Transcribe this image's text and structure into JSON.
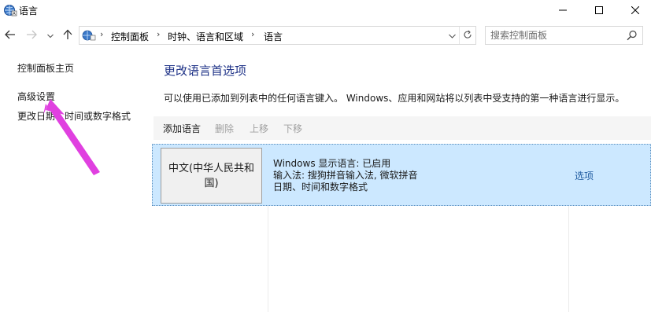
{
  "window": {
    "title": "语言",
    "icon": "globe-language-icon",
    "controls": {
      "minimize": "minimize-icon",
      "maximize": "maximize-icon",
      "close": "close-icon"
    }
  },
  "navigation": {
    "breadcrumbs": [
      "控制面板",
      "时钟、语言和区域",
      "语言"
    ],
    "search_placeholder": "搜索控制面板"
  },
  "sidebar": {
    "links": [
      {
        "label": "控制面板主页"
      },
      {
        "label": "高级设置"
      },
      {
        "label": "更改日期、时间或数字格式"
      }
    ]
  },
  "main": {
    "title": "更改语言首选项",
    "description": "可以使用已添加到列表中的任何语言键入。 Windows、应用和网站将以列表中受支持的第一种语言进行显示。",
    "toolbar": {
      "add": "添加语言",
      "remove": "删除",
      "move_up": "上移",
      "move_down": "下移"
    },
    "languages": [
      {
        "name": "中文(中华人民共和国)",
        "display_language": "Windows 显示语言: 已启用",
        "input_methods": "输入法: 搜狗拼音输入法, 微软拼音",
        "formats": "日期、时间和数字格式",
        "options_label": "选项"
      }
    ]
  },
  "colors": {
    "accent_title": "#1e3287",
    "selection": "#cce8ff",
    "link": "#1e5aa0",
    "annotation_arrow": "#e040e0"
  }
}
